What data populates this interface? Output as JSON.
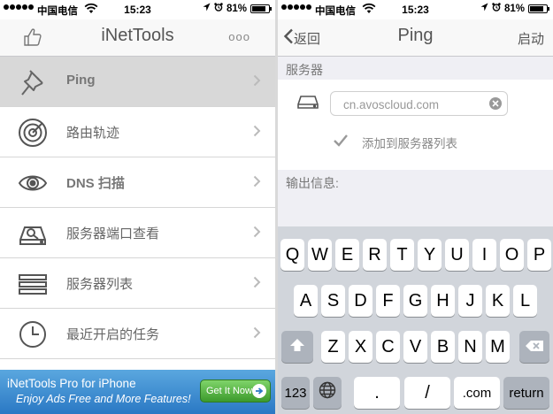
{
  "colors": {
    "accent_gray": "#555555",
    "ad_blue": "#2a78c4",
    "ad_button_green": "#3c9a2c",
    "selected_row": "#d8d8d8",
    "keyboard_bg": "#d1d5db"
  },
  "left": {
    "status": {
      "carrier": "中国电信",
      "time": "15:23",
      "battery": "81%",
      "battery_level": 0.81
    },
    "nav": {
      "title": "iNetTools",
      "left_icon": "thumbs-up-icon",
      "right_icon": "more-dots-icon",
      "more": "ooo"
    },
    "menu": [
      {
        "label": "Ping",
        "icon": "pushpin-icon",
        "selected": true,
        "bold": true
      },
      {
        "label": "路由轨迹",
        "icon": "radar-icon",
        "selected": false,
        "bold": false
      },
      {
        "label": "DNS 扫描",
        "icon": "eye-icon",
        "selected": false,
        "bold": true
      },
      {
        "label": "服务器端口查看",
        "icon": "port-scan-icon",
        "selected": false,
        "bold": false
      },
      {
        "label": "服务器列表",
        "icon": "list-lines-icon",
        "selected": false,
        "bold": false
      },
      {
        "label": "最近开启的任务",
        "icon": "clock-icon",
        "selected": false,
        "bold": false
      }
    ],
    "ad": {
      "line1": "iNetTools Pro for iPhone",
      "line2": "Enjoy Ads Free and More Features!",
      "button": "Get It Now!"
    }
  },
  "right": {
    "status": {
      "carrier": "中国电信",
      "time": "15:23",
      "battery": "81%",
      "battery_level": 0.81
    },
    "nav": {
      "back": "返回",
      "title": "Ping",
      "action": "启动"
    },
    "server_section": "服务器",
    "host_value": "cn.avoscloud.com",
    "add_to_list": "添加到服务器列表",
    "add_checked": true,
    "output_section": "输出信息:",
    "keyboard": {
      "row1": [
        "Q",
        "W",
        "E",
        "R",
        "T",
        "Y",
        "U",
        "I",
        "O",
        "P"
      ],
      "row2": [
        "A",
        "S",
        "D",
        "F",
        "G",
        "H",
        "J",
        "K",
        "L"
      ],
      "row3": [
        "Z",
        "X",
        "C",
        "V",
        "B",
        "N",
        "M"
      ],
      "numbers": "123",
      "period": ".",
      "slash": "/",
      "dotcom": ".com",
      "return": "return"
    }
  }
}
